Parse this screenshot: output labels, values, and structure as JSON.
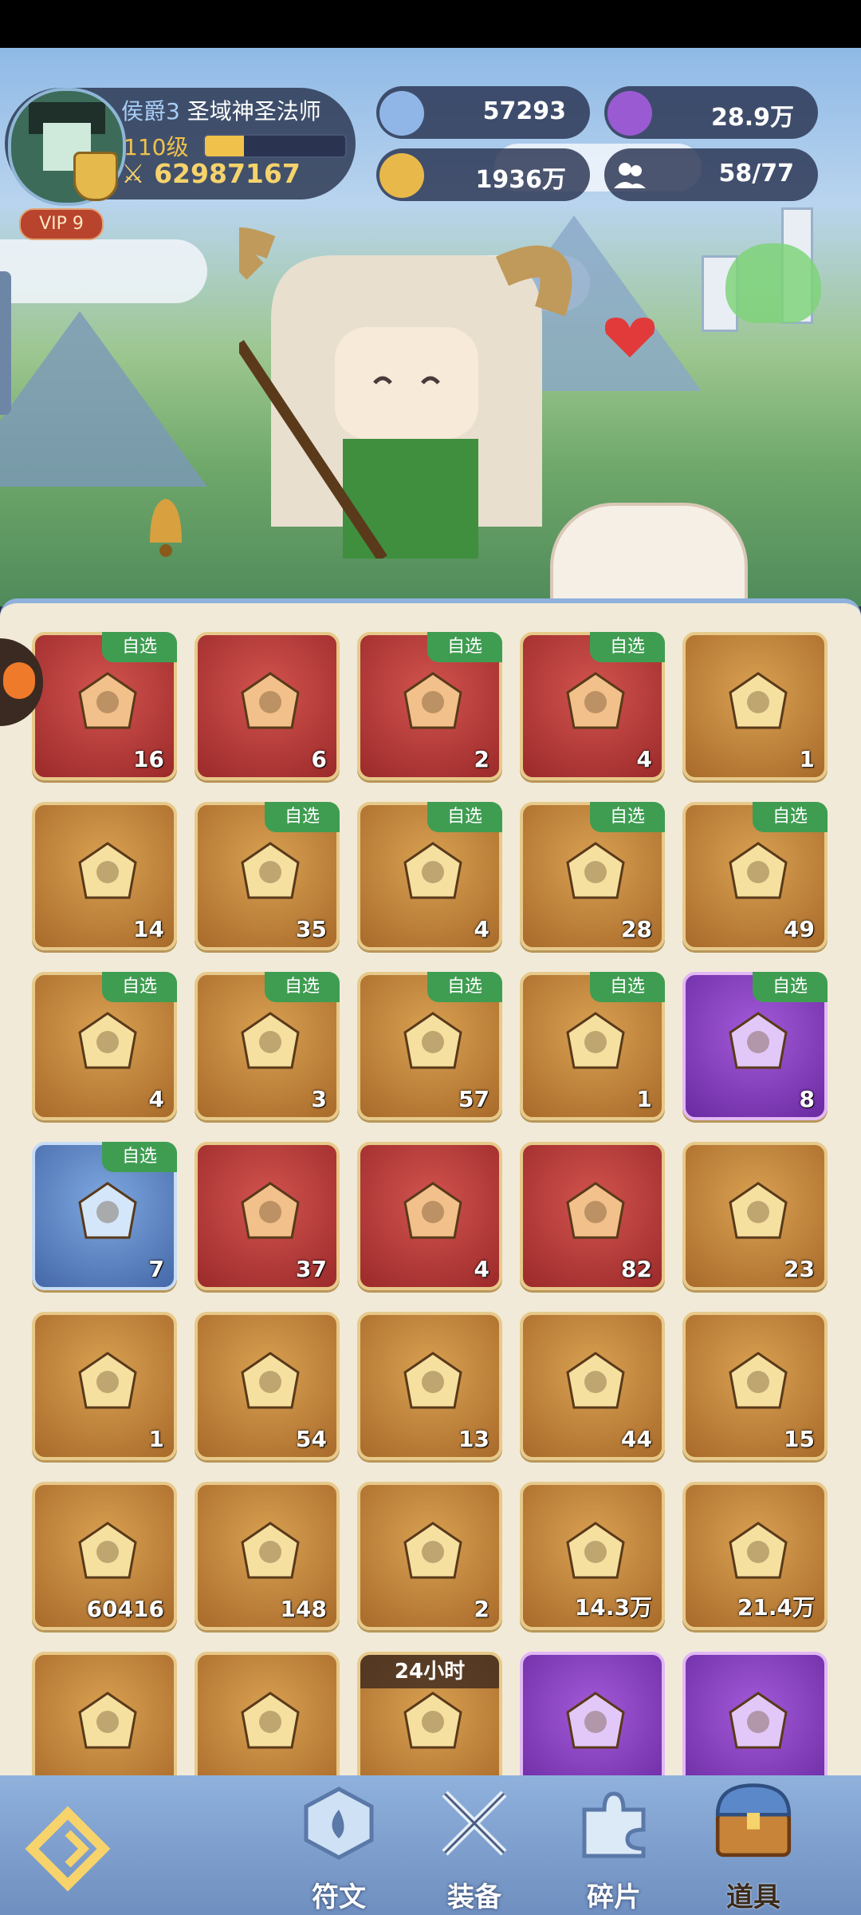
{
  "player": {
    "rank": "侯爵3",
    "title": "圣域神圣法师",
    "level": "110级",
    "xp_fraction": 0.28,
    "power": "62987167",
    "vip": "VIP 9"
  },
  "resources": [
    {
      "name": "star-gem",
      "value": "57293"
    },
    {
      "name": "purple-coin",
      "value": "28.9万"
    },
    {
      "name": "gold-coin",
      "value": "1936万"
    },
    {
      "name": "party",
      "value": "58/77"
    }
  ],
  "inventory": {
    "select_tag": "自选",
    "timer_tag": "24小时",
    "items": [
      {
        "icon": "egg-bundle-icon",
        "rarity": "red",
        "count": "16",
        "selectable": true
      },
      {
        "icon": "red-crystal-icon",
        "rarity": "red",
        "count": "6",
        "selectable": false
      },
      {
        "icon": "treasure-chest-icon",
        "rarity": "red",
        "count": "2",
        "selectable": true
      },
      {
        "icon": "mystery-chest-icon",
        "rarity": "red",
        "count": "4",
        "selectable": true
      },
      {
        "icon": "gold-card-icon",
        "rarity": "gold",
        "count": "1",
        "selectable": false
      },
      {
        "icon": "gold-crystal-icon",
        "rarity": "gold",
        "count": "14",
        "selectable": false
      },
      {
        "icon": "creature-nest-icon",
        "rarity": "gold",
        "count": "35",
        "selectable": true
      },
      {
        "icon": "gem-chest-icon",
        "rarity": "gold",
        "count": "4",
        "selectable": true
      },
      {
        "icon": "gift-box-icon",
        "rarity": "gold",
        "count": "28",
        "selectable": true
      },
      {
        "icon": "orb-chest-icon",
        "rarity": "gold",
        "count": "49",
        "selectable": true
      },
      {
        "icon": "crystal-chest-icon",
        "rarity": "gold",
        "count": "4",
        "selectable": true
      },
      {
        "icon": "purple-orb-chest-icon",
        "rarity": "gold",
        "count": "3",
        "selectable": true
      },
      {
        "icon": "ruby-chest-icon",
        "rarity": "gold",
        "count": "57",
        "selectable": true
      },
      {
        "icon": "rune-chest-icon",
        "rarity": "gold",
        "count": "1",
        "selectable": true
      },
      {
        "icon": "purple-chest-icon",
        "rarity": "purple",
        "count": "8",
        "selectable": true
      },
      {
        "icon": "blue-rune-chest-icon",
        "rarity": "blue",
        "count": "7",
        "selectable": true
      },
      {
        "icon": "lotus-icon",
        "rarity": "red",
        "count": "37",
        "selectable": false
      },
      {
        "icon": "blue-ticket-icon",
        "rarity": "red",
        "count": "4",
        "selectable": false
      },
      {
        "icon": "sun-ticket-icon",
        "rarity": "red",
        "count": "82",
        "selectable": false
      },
      {
        "icon": "coral-icon",
        "rarity": "gold",
        "count": "23",
        "selectable": false
      },
      {
        "icon": "orange-ticket-icon",
        "rarity": "gold",
        "count": "1",
        "selectable": false
      },
      {
        "icon": "star-crystal-icon",
        "rarity": "gold",
        "count": "54",
        "selectable": false
      },
      {
        "icon": "green-crystal-icon",
        "rarity": "gold",
        "count": "13",
        "selectable": false
      },
      {
        "icon": "heart-ticket-icon",
        "rarity": "gold",
        "count": "44",
        "selectable": false
      },
      {
        "icon": "rainbow-potion-icon",
        "rarity": "gold",
        "count": "15",
        "selectable": false
      },
      {
        "icon": "lock-coin-icon",
        "rarity": "gold",
        "count": "60416",
        "selectable": false
      },
      {
        "icon": "lightning-potion-icon",
        "rarity": "gold",
        "count": "148",
        "selectable": false
      },
      {
        "icon": "blue-key-icon",
        "rarity": "gold",
        "count": "2",
        "selectable": false
      },
      {
        "icon": "gold-medal-icon",
        "rarity": "gold",
        "count": "14.3万",
        "selectable": false
      },
      {
        "icon": "purple-medal-icon",
        "rarity": "gold",
        "count": "21.4万",
        "selectable": false
      },
      {
        "icon": "dragon-egg-icon",
        "rarity": "gold",
        "count": "",
        "selectable": false
      },
      {
        "icon": "swap-potion-icon",
        "rarity": "gold",
        "count": "",
        "selectable": false
      },
      {
        "icon": "coin-chest-icon",
        "rarity": "gold",
        "count": "",
        "selectable": false,
        "timed": true
      },
      {
        "icon": "diamond-icon",
        "rarity": "purple",
        "count": "",
        "selectable": false
      },
      {
        "icon": "hourglass-icon",
        "rarity": "purple",
        "count": "",
        "selectable": false
      }
    ]
  },
  "nav": {
    "tabs": [
      {
        "label": "符文",
        "icon": "rune-icon"
      },
      {
        "label": "装备",
        "icon": "crossed-swords-icon"
      },
      {
        "label": "碎片",
        "icon": "puzzle-icon"
      },
      {
        "label": "道具",
        "icon": "chest-icon",
        "active": true
      }
    ]
  },
  "colors": {
    "red_slot": "#b23a37",
    "gold_slot": "#c2833c",
    "purple_slot": "#8a44c4",
    "blue_slot": "#5b80c0",
    "select_tag": "#3f9d52"
  }
}
